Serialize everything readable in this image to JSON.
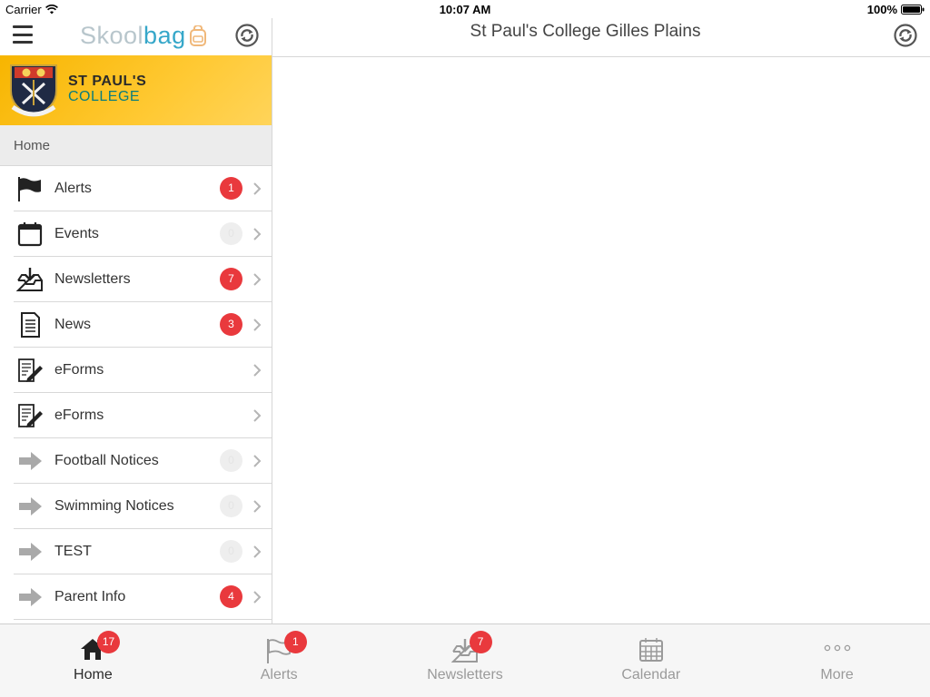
{
  "status_bar": {
    "carrier": "Carrier",
    "time": "10:07 AM",
    "battery": "100%"
  },
  "sidebar": {
    "brand": {
      "part1": "Skool",
      "part2": "bag"
    },
    "school": {
      "line1": "ST PAUL'S",
      "line2": "COLLEGE"
    },
    "section_label": "Home",
    "items": [
      {
        "label": "Alerts",
        "badge": "1",
        "icon": "flag-icon"
      },
      {
        "label": "Events",
        "badge": "0",
        "icon": "calendar-icon"
      },
      {
        "label": "Newsletters",
        "badge": "7",
        "icon": "inbox-download-icon"
      },
      {
        "label": "News",
        "badge": "3",
        "icon": "document-icon"
      },
      {
        "label": "eForms",
        "badge": "",
        "icon": "form-edit-icon"
      },
      {
        "label": "eForms",
        "badge": "",
        "icon": "form-edit-icon"
      },
      {
        "label": "Football Notices",
        "badge": "0",
        "icon": "arrow-right-icon"
      },
      {
        "label": "Swimming Notices",
        "badge": "0",
        "icon": "arrow-right-icon"
      },
      {
        "label": "TEST",
        "badge": "0",
        "icon": "arrow-right-icon"
      },
      {
        "label": "Parent Info",
        "badge": "4",
        "icon": "arrow-right-icon"
      }
    ]
  },
  "main": {
    "title": "St Paul's College Gilles Plains"
  },
  "tabs": [
    {
      "label": "Home",
      "badge": "17",
      "icon": "home-icon",
      "active": true
    },
    {
      "label": "Alerts",
      "badge": "1",
      "icon": "flag-icon",
      "active": false
    },
    {
      "label": "Newsletters",
      "badge": "7",
      "icon": "inbox-download-icon",
      "active": false
    },
    {
      "label": "Calendar",
      "badge": "",
      "icon": "calendar-icon",
      "active": false
    },
    {
      "label": "More",
      "badge": "",
      "icon": "more-dots-icon",
      "active": false
    }
  ],
  "colors": {
    "badge_red": "#e9393d",
    "banner_yellow": "#f7b500",
    "brand_blue": "#36a7c9",
    "brand_grey": "#b8c6cc"
  }
}
